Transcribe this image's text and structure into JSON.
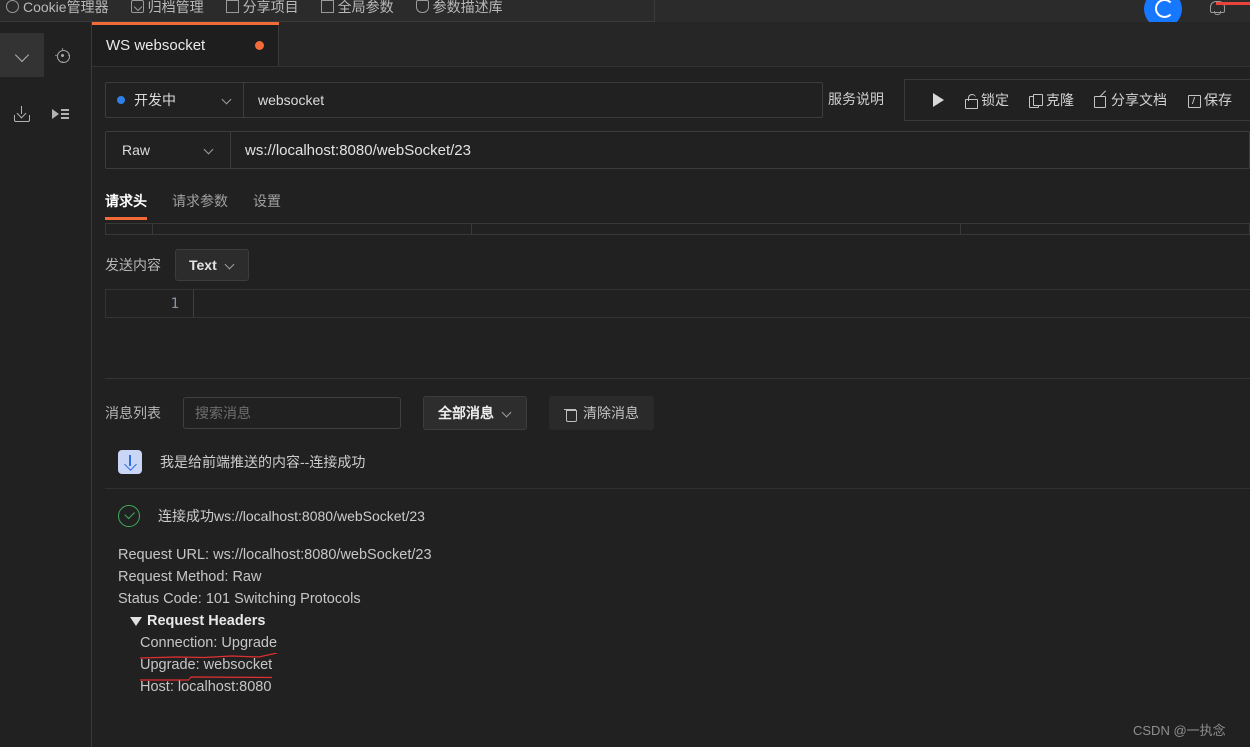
{
  "top_menu": {
    "items": [
      {
        "label": "Cookie管理器",
        "icon": "cookie-icon"
      },
      {
        "label": "归档管理",
        "icon": "archive-icon"
      },
      {
        "label": "分享项目",
        "icon": "share-project-icon"
      },
      {
        "label": "全局参数",
        "icon": "global-params-icon"
      },
      {
        "label": "参数描述库",
        "icon": "param-desc-icon"
      }
    ],
    "avatar": "user-avatar",
    "bell": "notification-bell-icon"
  },
  "left_rail": {
    "collapse": "chevron-down-icon",
    "locate": "target-icon",
    "download": "download-icon",
    "run_list": "run-list-icon"
  },
  "tab": {
    "label": "WS websocket",
    "unsaved": true,
    "accent_color": "#f26b38"
  },
  "request": {
    "env_name": "开发中",
    "env_dot_color": "#2e7fe8",
    "name": "websocket",
    "protocol": "Raw",
    "url": "ws://localhost:8080/webSocket/23",
    "service_doc": "服务说明",
    "actions": [
      {
        "label": "",
        "icon": "play-icon"
      },
      {
        "label": "锁定",
        "icon": "lock-icon"
      },
      {
        "label": "克隆",
        "icon": "copy-icon"
      },
      {
        "label": "分享文档",
        "icon": "share-icon"
      },
      {
        "label": "保存",
        "icon": "save-icon"
      }
    ]
  },
  "inner_tabs": [
    {
      "label": "请求头",
      "active": true
    },
    {
      "label": "请求参数",
      "active": false
    },
    {
      "label": "设置",
      "active": false
    }
  ],
  "send": {
    "label": "发送内容",
    "format": "Text",
    "line_number": "1",
    "content": ""
  },
  "message_panel": {
    "label": "消息列表",
    "search_placeholder": "搜索消息",
    "search_value": "",
    "filter": "全部消息",
    "clear": "清除消息",
    "rows": [
      {
        "icon": "arrow-down-icon",
        "text": "我是给前端推送的内容--连接成功",
        "kind": "incoming"
      },
      {
        "icon": "check-circle-icon",
        "text": "连接成功ws://localhost:8080/webSocket/23",
        "kind": "success"
      }
    ]
  },
  "detail": {
    "lines": [
      {
        "text": "Request URL: ws://localhost:8080/webSocket/23",
        "style": "plain"
      },
      {
        "text": "Request Method: Raw",
        "style": "plain"
      },
      {
        "text": "Status Code: 101 Switching Protocols",
        "style": "plain"
      },
      {
        "text": "Request Headers",
        "style": "header"
      },
      {
        "text": "Connection: Upgrade",
        "style": "indent",
        "annotated": true
      },
      {
        "text": "Upgrade: websocket",
        "style": "indent",
        "annotated": true
      },
      {
        "text": "Host: localhost:8080",
        "style": "indent",
        "annotated": false
      }
    ],
    "annotation_color": "#e03131"
  },
  "watermark": "CSDN @一执念"
}
